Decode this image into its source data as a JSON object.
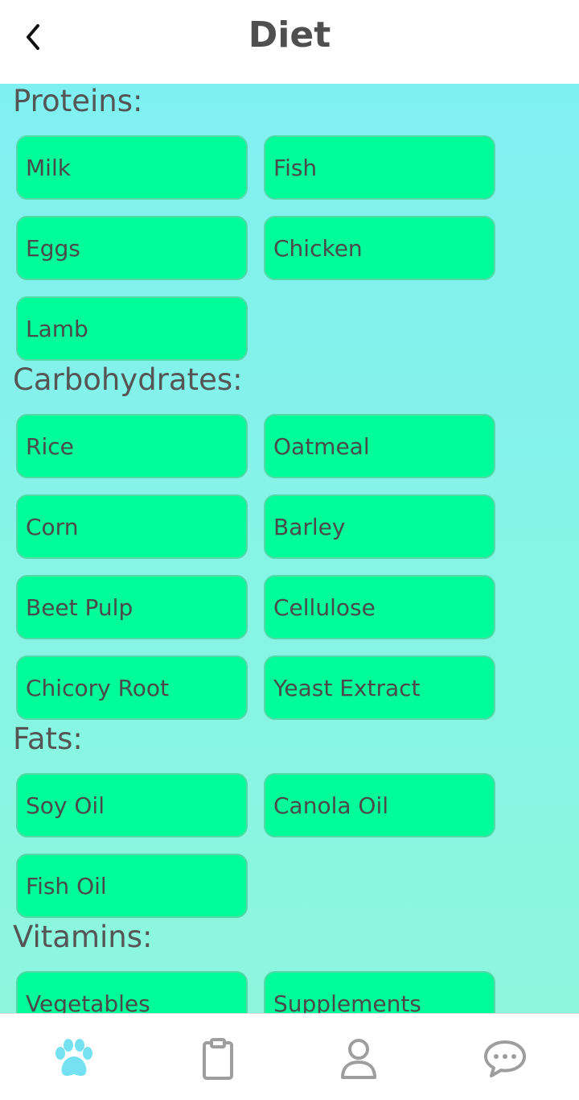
{
  "header": {
    "title": "Diet"
  },
  "sections": [
    {
      "title": "Proteins:",
      "items": [
        "Milk",
        "Fish",
        "Eggs",
        "Chicken",
        "Lamb"
      ]
    },
    {
      "title": "Carbohydrates:",
      "items": [
        "Rice",
        "Oatmeal",
        "Corn",
        "Barley",
        "Beet Pulp",
        "Cellulose",
        "Chicory Root",
        "Yeast Extract"
      ]
    },
    {
      "title": "Fats:",
      "items": [
        "Soy Oil",
        "Canola Oil",
        "Fish Oil"
      ]
    },
    {
      "title": "Vitamins:",
      "items": [
        "Vegetables",
        "Supplements"
      ]
    }
  ],
  "tabbar": {
    "tabs": [
      {
        "icon": "paw-icon",
        "active": true
      },
      {
        "icon": "clipboard-icon",
        "active": false
      },
      {
        "icon": "profile-icon",
        "active": false
      },
      {
        "icon": "chat-icon",
        "active": false
      }
    ]
  },
  "colors": {
    "accent": "#75e2f1",
    "chip": "#00fd99",
    "chip_border": "#52d9a7",
    "text": "#4f4f4f",
    "inactive_icon": "#9e9e9e",
    "gradient_top": "#7ff0f1",
    "gradient_bottom": "#8df7dd"
  }
}
